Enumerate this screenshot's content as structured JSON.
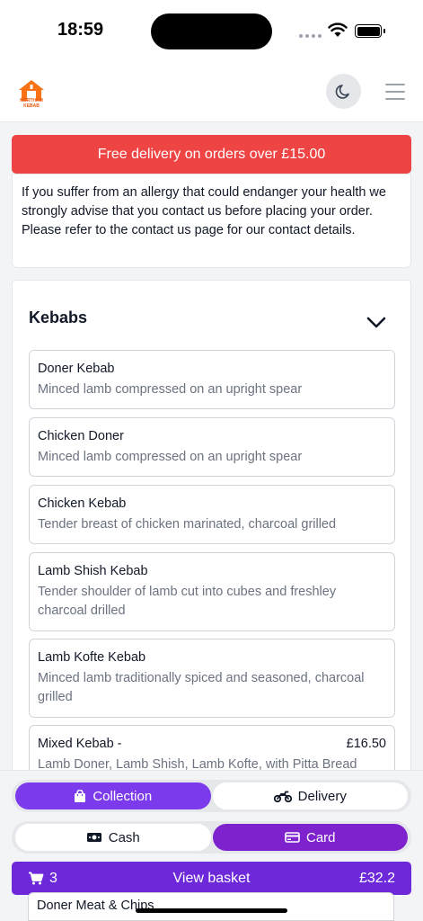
{
  "status_bar": {
    "time": "18:59"
  },
  "header": {
    "logo_text": "MERTHAM KEBAB"
  },
  "promo": {
    "text": "Free delivery on orders over £15.00"
  },
  "allergy": {
    "text": "If you suffer from an allergy that could endanger your health we strongly advise that you contact us before placing your order. Please refer to the contact us page for our contact details."
  },
  "section": {
    "title": "Kebabs",
    "items": [
      {
        "name": "Doner Kebab",
        "desc": "Minced lamb compressed on an upright spear",
        "price": ""
      },
      {
        "name": "Chicken Doner",
        "desc": "Minced lamb compressed on an upright spear",
        "price": ""
      },
      {
        "name": "Chicken Kebab",
        "desc": "Tender breast of chicken marinated, charcoal grilled",
        "price": ""
      },
      {
        "name": "Lamb Shish Kebab",
        "desc": "Tender shoulder of lamb cut into cubes and freshley charcoal drilled",
        "price": ""
      },
      {
        "name": "Lamb Kofte Kebab",
        "desc": "Minced lamb traditionally spiced and seasoned, charcoal grilled",
        "price": ""
      },
      {
        "name": "Mixed Kebab -",
        "desc": "Lamb Doner, Lamb Shish, Lamb Kofte, with Pitta Bread",
        "price": "£16.50"
      },
      {
        "name": "Doner Meat & Chips",
        "desc": "",
        "price": ""
      }
    ]
  },
  "order_type": {
    "collection": "Collection",
    "delivery": "Delivery",
    "selected": "Collection"
  },
  "payment": {
    "cash": "Cash",
    "card": "Card",
    "selected": "Card"
  },
  "basket": {
    "count": "3",
    "label": "View basket",
    "total": "£32.2"
  },
  "colors": {
    "promo": "#ef4444",
    "accent": "#7e22ce",
    "basket": "#6d28d9"
  }
}
